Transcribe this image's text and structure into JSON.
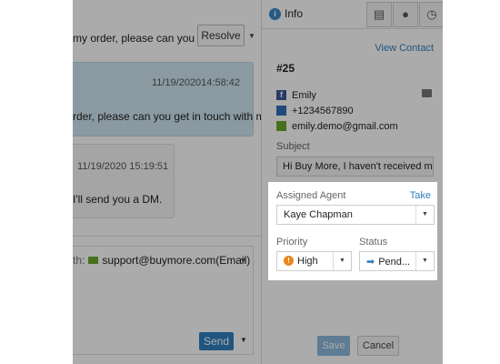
{
  "conversation": {
    "subject_preview": "my order, please can you ...",
    "resolve_label": "Resolve",
    "incoming": {
      "timestamp": "11/19/202014:58:42",
      "text": "rder, please can you get in touch with me?"
    },
    "outgoing": {
      "timestamp": "11/19/2020 15:19:51",
      "text": "I'll send you a DM."
    },
    "compose": {
      "from_label": "th:",
      "from_value": "support@buymore.com(Email)",
      "send_label": "Send"
    }
  },
  "info": {
    "tab_label": "Info",
    "view_contact": "View Contact",
    "ticket_id": "#25",
    "contact": {
      "name": "Emily",
      "phone": "+1234567890",
      "email": "emily.demo@gmail.com"
    },
    "subject_label": "Subject",
    "subject_value": "Hi Buy More, I haven't received my",
    "assigned_agent_label": "Assigned Agent",
    "take_label": "Take",
    "assigned_agent_value": "Kaye Chapman",
    "priority_label": "Priority",
    "priority_value": "High",
    "status_label": "Status",
    "status_value": "Pend...",
    "save_label": "Save",
    "cancel_label": "Cancel"
  },
  "colors": {
    "accent": "#2f7fc0",
    "incoming_bubble": "#cfe6f2",
    "priority_high": "#e8861e",
    "email_icon": "#6aa82a",
    "facebook": "#3b5998"
  }
}
